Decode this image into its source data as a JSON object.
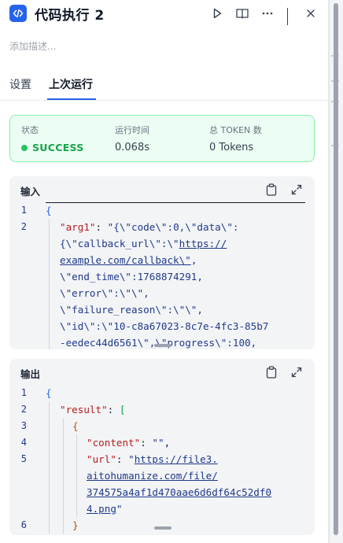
{
  "node": {
    "title": "代码执行 2",
    "description_placeholder": "添加描述..."
  },
  "tabs": [
    {
      "label": "设置"
    },
    {
      "label": "上次运行"
    }
  ],
  "status": {
    "state_label": "状态",
    "state_value": "SUCCESS",
    "time_label": "运行时间",
    "time_value": "0.068s",
    "token_label": "总 TOKEN 数",
    "token_value": "0 Tokens"
  },
  "input_panel": {
    "title": "输入",
    "lines": [
      {
        "no": "1",
        "parts": [
          {
            "t": "{",
            "c": "brace"
          }
        ]
      },
      {
        "no": "2",
        "parts": [
          {
            "t": "\"arg1\"",
            "c": "key"
          },
          {
            "t": ": ",
            "c": "plain"
          },
          {
            "t": "\"{\\\"code\\\":0,\\\"data\\\":",
            "c": "str"
          }
        ]
      },
      {
        "no": "",
        "parts": [
          {
            "t": "{\\\"callback_url\\\":\\\"",
            "c": "str"
          },
          {
            "t": "https://",
            "c": "url"
          }
        ]
      },
      {
        "no": "",
        "parts": [
          {
            "t": "example.com/callback\\\"",
            "c": "url"
          },
          {
            "t": ",",
            "c": "str"
          }
        ]
      },
      {
        "no": "",
        "parts": [
          {
            "t": "\\\"end_time\\\":1768874291,",
            "c": "str"
          }
        ]
      },
      {
        "no": "",
        "parts": [
          {
            "t": "\\\"error\\\":\\\"\\\",",
            "c": "str"
          }
        ]
      },
      {
        "no": "",
        "parts": [
          {
            "t": "\\\"failure_reason\\\":\\\"\\\",",
            "c": "str"
          }
        ]
      },
      {
        "no": "",
        "parts": [
          {
            "t": "\\\"id\\\":\\\"10-c8a67023-8c7e-4fc3-85b7",
            "c": "str"
          }
        ]
      },
      {
        "no": "",
        "parts": [
          {
            "t": "-eedec44d6561\\\",\\\"progress\\\":100,",
            "c": "str"
          }
        ]
      }
    ]
  },
  "output_panel": {
    "title": "输出",
    "lines": [
      {
        "no": "1",
        "parts": [
          {
            "t": "{",
            "c": "brace"
          }
        ]
      },
      {
        "no": "2",
        "parts": [
          {
            "t": "\"result\"",
            "c": "key"
          },
          {
            "t": ": ",
            "c": "plain"
          },
          {
            "t": "[",
            "c": "bracket"
          }
        ]
      },
      {
        "no": "3",
        "parts": [
          {
            "t": "{",
            "c": "brace2"
          }
        ]
      },
      {
        "no": "4",
        "parts": [
          {
            "t": "\"content\"",
            "c": "key"
          },
          {
            "t": ": ",
            "c": "plain"
          },
          {
            "t": "\"\"",
            "c": "str"
          },
          {
            "t": ",",
            "c": "plain"
          }
        ]
      },
      {
        "no": "5",
        "parts": [
          {
            "t": "\"url\"",
            "c": "key"
          },
          {
            "t": ": ",
            "c": "plain"
          },
          {
            "t": "\"",
            "c": "str"
          },
          {
            "t": "https://file3.",
            "c": "url"
          }
        ]
      },
      {
        "no": "",
        "parts": [
          {
            "t": "aitohumanize.com/file/",
            "c": "url"
          }
        ]
      },
      {
        "no": "",
        "parts": [
          {
            "t": "374575a4af1d470aae6d6df64c52df0",
            "c": "url"
          }
        ]
      },
      {
        "no": "",
        "parts": [
          {
            "t": "4.png",
            "c": "url"
          },
          {
            "t": "\"",
            "c": "str"
          }
        ]
      },
      {
        "no": "6",
        "parts": [
          {
            "t": "}",
            "c": "brace2"
          }
        ]
      }
    ]
  },
  "colors": {
    "accent": "#2563eb",
    "success": "#16a34a",
    "success_bg": "#ecfdf3"
  }
}
